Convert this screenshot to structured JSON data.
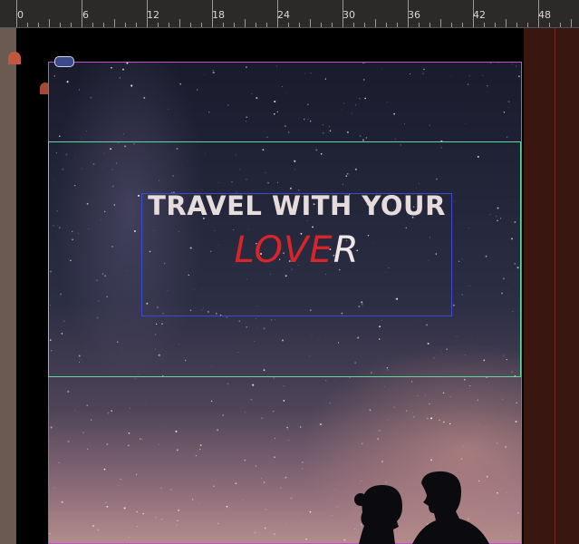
{
  "ruler": {
    "labels": [
      "0",
      "6",
      "12",
      "18",
      "24",
      "30",
      "36",
      "42",
      "48"
    ]
  },
  "design": {
    "headline": "TRAVEL WITH YOUR",
    "love_red": "LOVE",
    "love_white": "R"
  },
  "colors": {
    "accent_red": "#d9252a",
    "text_light": "#e7dcdc",
    "frame_green": "#5fd8a0",
    "frame_blue": "#3b4bd0",
    "frame_magenta": "#c04fd0"
  }
}
